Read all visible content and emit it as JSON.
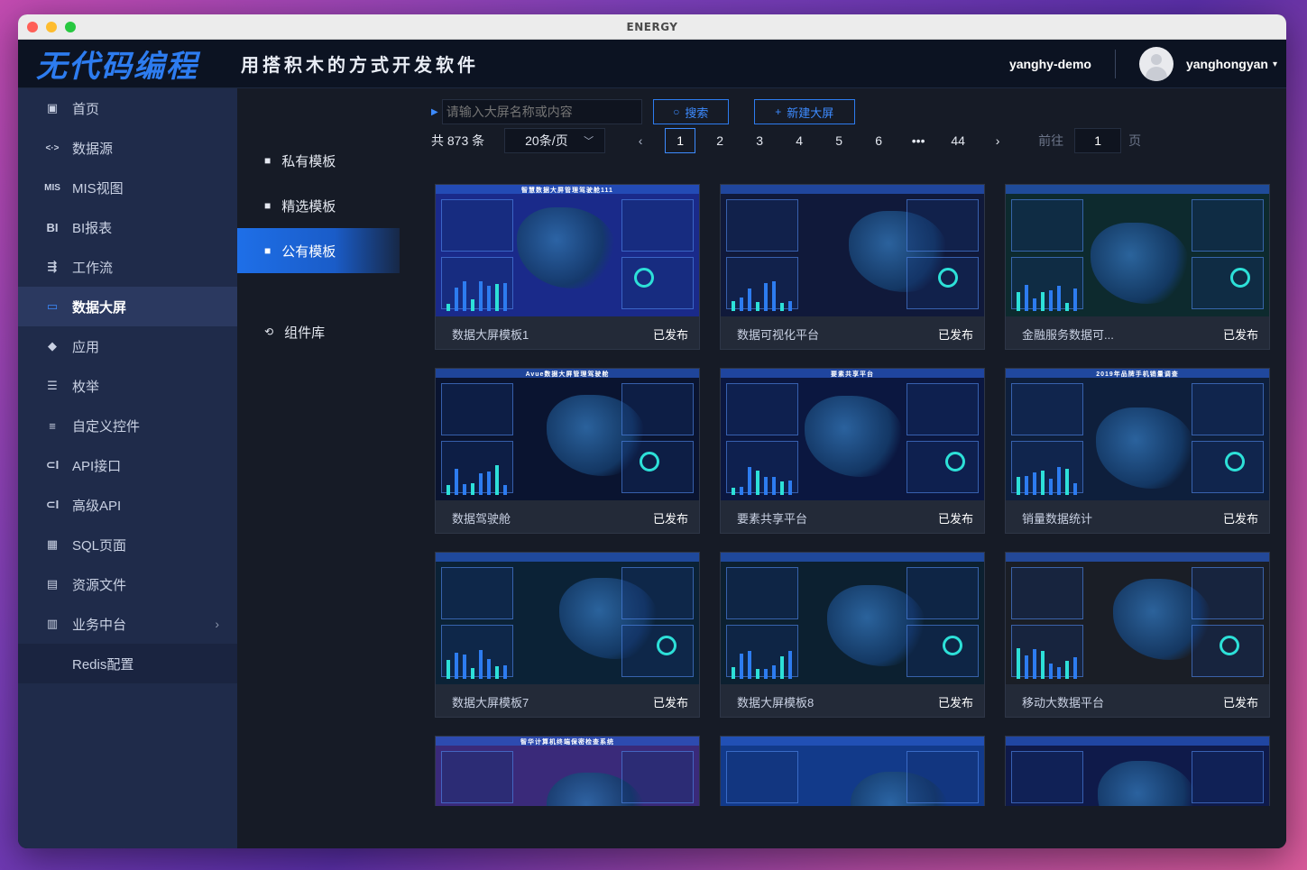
{
  "window": {
    "title": "ENERGY"
  },
  "header": {
    "logo": "无代码编程",
    "slogan": "用搭积木的方式开发软件",
    "tenant": "yanghy-demo",
    "username": "yanghongyan",
    "caret": "▾"
  },
  "sidebar": {
    "items": [
      {
        "icon": "▣",
        "icon_name": "home-icon",
        "label": "首页"
      },
      {
        "icon": "<·>",
        "icon_name": "datasource-icon",
        "label": "数据源"
      },
      {
        "icon": "MIS",
        "icon_name": "mis-icon",
        "label": "MIS视图"
      },
      {
        "icon": "BI",
        "icon_name": "bi-icon",
        "label": "BI报表"
      },
      {
        "icon": "⇶",
        "icon_name": "workflow-icon",
        "label": "工作流"
      },
      {
        "icon": "▭",
        "icon_name": "screen-icon",
        "label": "数据大屏",
        "active": true
      },
      {
        "icon": "◆",
        "icon_name": "app-icon",
        "label": "应用"
      },
      {
        "icon": "☰",
        "icon_name": "enum-icon",
        "label": "枚举"
      },
      {
        "icon": "≡",
        "icon_name": "custom-control-icon",
        "label": "自定义控件"
      },
      {
        "icon": "⊂I",
        "icon_name": "api-icon",
        "label": "API接口"
      },
      {
        "icon": "⊂I",
        "icon_name": "advanced-api-icon",
        "label": "高级API"
      },
      {
        "icon": "▦",
        "icon_name": "sql-page-icon",
        "label": "SQL页面"
      },
      {
        "icon": "▤",
        "icon_name": "resource-file-icon",
        "label": "资源文件"
      },
      {
        "icon": "▥",
        "icon_name": "business-center-icon",
        "label": "业务中台",
        "arrow": "›"
      }
    ],
    "sub_item": "Redis配置"
  },
  "subnav": {
    "items": [
      {
        "icon": "■",
        "label": "私有模板"
      },
      {
        "icon": "■",
        "label": "精选模板"
      },
      {
        "icon": "■",
        "label": "公有模板",
        "active": true
      },
      {
        "icon": "⟲",
        "label": "组件库"
      }
    ]
  },
  "toolbar": {
    "search_placeholder": "请输入大屏名称或内容",
    "search_icon": "○",
    "search_label": "搜索",
    "new_icon": "+",
    "new_label": "新建大屏"
  },
  "pager": {
    "total": "共 873 条",
    "page_size": "20条/页",
    "prev": "‹",
    "pages": [
      "1",
      "2",
      "3",
      "4",
      "5",
      "6",
      "•••",
      "44"
    ],
    "current": "1",
    "next": "›",
    "goto_label": "前往",
    "goto_value": "1",
    "goto_suffix": "页"
  },
  "cards": [
    {
      "name": "数据大屏模板1",
      "status": "已发布",
      "thumb_title": "智慧数据大屏管理驾驶舱111",
      "bg": "#1a2a8a"
    },
    {
      "name": "数据可视化平台",
      "status": "已发布",
      "thumb_title": "",
      "bg": "#10193a"
    },
    {
      "name": "金融服务数据可...",
      "status": "已发布",
      "thumb_title": "",
      "bg": "#0d2a2e"
    },
    {
      "name": "数据驾驶舱",
      "status": "已发布",
      "thumb_title": "Avue数据大屏管理驾驶舱",
      "bg": "#0a1430"
    },
    {
      "name": "要素共享平台",
      "status": "已发布",
      "thumb_title": "要素共享平台",
      "bg": "#0b1740"
    },
    {
      "name": "销量数据统计",
      "status": "已发布",
      "thumb_title": "2019年品牌手机销量调查",
      "bg": "#0e1f3c"
    },
    {
      "name": "数据大屏模板7",
      "status": "已发布",
      "thumb_title": "",
      "bg": "#0b2236"
    },
    {
      "name": "数据大屏模板8",
      "status": "已发布",
      "thumb_title": "",
      "bg": "#0c2030"
    },
    {
      "name": "移动大数据平台",
      "status": "已发布",
      "thumb_title": "",
      "bg": "#1a1e26"
    },
    {
      "name": "",
      "status": "",
      "thumb_title": "智华计算机终端保密检查系统",
      "bg": "#3a2a7a"
    },
    {
      "name": "",
      "status": "",
      "thumb_title": "",
      "bg": "#123a8a"
    },
    {
      "name": "",
      "status": "",
      "thumb_title": "",
      "bg": "#0f1a4a"
    }
  ]
}
